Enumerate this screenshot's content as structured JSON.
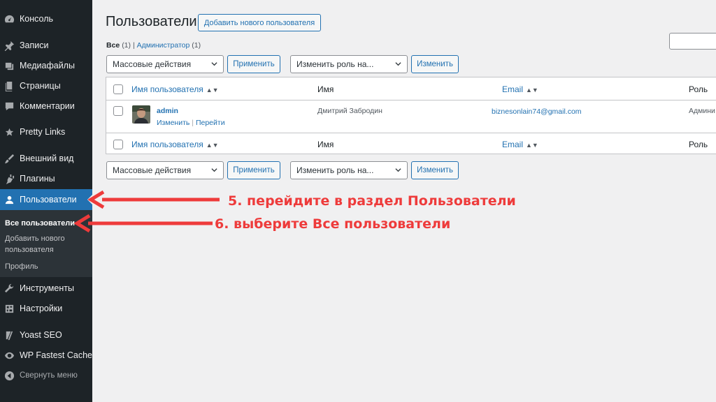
{
  "sidebar": {
    "items": [
      {
        "label": "Консоль",
        "icon": "dashboard-icon"
      },
      {
        "label": "Записи",
        "icon": "pin-icon"
      },
      {
        "label": "Медиафайлы",
        "icon": "media-icon"
      },
      {
        "label": "Страницы",
        "icon": "pages-icon"
      },
      {
        "label": "Комментарии",
        "icon": "comments-icon"
      },
      {
        "label": "Pretty Links",
        "icon": "star-icon"
      },
      {
        "label": "Внешний вид",
        "icon": "appearance-icon"
      },
      {
        "label": "Плагины",
        "icon": "plugins-icon"
      },
      {
        "label": "Пользователи",
        "icon": "users-icon"
      },
      {
        "label": "Инструменты",
        "icon": "tools-icon"
      },
      {
        "label": "Настройки",
        "icon": "settings-icon"
      },
      {
        "label": "Yoast SEO",
        "icon": "yoast-icon"
      },
      {
        "label": "WP Fastest Cache",
        "icon": "cache-icon"
      },
      {
        "label": "Свернуть меню",
        "icon": "collapse-icon"
      }
    ],
    "submenu": {
      "all_users": "Все пользователи",
      "add_new": "Добавить нового пользователя",
      "profile": "Профиль"
    }
  },
  "page": {
    "title": "Пользователи",
    "add_new_button": "Добавить нового пользователя",
    "filters": {
      "all_label": "Все",
      "all_count": "(1)",
      "separator": "|",
      "admin_label": "Администратор",
      "admin_count": "(1)"
    }
  },
  "toolbar": {
    "bulk_actions": "Массовые действия",
    "apply": "Применить",
    "change_role": "Изменить роль на...",
    "change": "Изменить"
  },
  "table": {
    "columns": {
      "username": "Имя пользователя",
      "name": "Имя",
      "email": "Email",
      "role": "Роль"
    },
    "rows": [
      {
        "username": "admin",
        "edit": "Изменить",
        "separator": "|",
        "view": "Перейти",
        "name": "Дмитрий Забродин",
        "email": "biznesonlain74@gmail.com",
        "role": "Админи"
      }
    ]
  },
  "annotations": {
    "step5": "5. перейдите в раздел Пользователи",
    "step6": "6. выберите Все пользователи"
  },
  "colors": {
    "sidebar_bg": "#1d2327",
    "accent": "#2271b1",
    "annotation": "#ee3b3b"
  }
}
